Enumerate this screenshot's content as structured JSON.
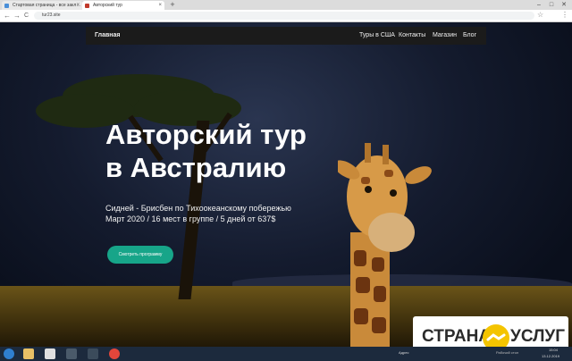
{
  "browser": {
    "tabs": [
      {
        "title": "Стартовая страница - все закл…",
        "active": false
      },
      {
        "title": "Авторский тур",
        "active": true
      }
    ],
    "new_tab_symbol": "+",
    "close_symbol": "×",
    "url": "tur23.site",
    "window_controls": [
      "–",
      "□",
      "✕"
    ],
    "nav_icons": {
      "back": "←",
      "forward": "→",
      "reload": "C"
    }
  },
  "site": {
    "nav": {
      "home": "Главная",
      "links": [
        "Туры в США",
        "Контакты",
        "Магазин",
        "Блог"
      ]
    },
    "hero": {
      "title_line1": "Авторский тур",
      "title_line2": "в Австралию",
      "subtitle_line1": "Сидней - Брисбен по Тихоокеанскому побережью",
      "subtitle_line2": "Март 2020 / 16 мест в группе / 5 дней от 637$",
      "cta_label": "Смотреть программу"
    }
  },
  "badge": {
    "left": "СТРАНА",
    "right": "УСЛУГ"
  },
  "taskbar": {
    "start_icon": "windows-start-icon",
    "apps": [
      "folder-icon",
      "yandex-icon",
      "media-icon",
      "camera-icon",
      "chrome-icon"
    ],
    "address_label": "Адрес",
    "tray_text": "Рабочий стол",
    "time": "15:04",
    "date": "13.12.2019"
  },
  "colors": {
    "accent": "#17a589",
    "navbar": "#1b1b1b",
    "taskbar": "#1c2a3d"
  }
}
